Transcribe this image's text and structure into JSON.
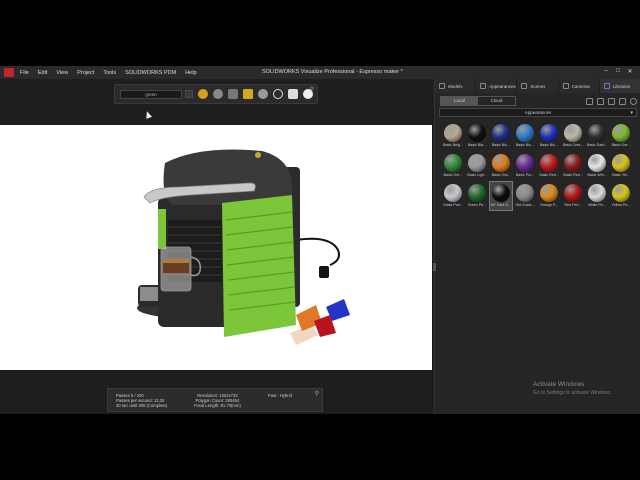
{
  "window": {
    "title": "SOLIDWORKS Visualize Professional - Espresso maker *",
    "controls": [
      "–",
      "□",
      "✕"
    ]
  },
  "menu": [
    "File",
    "Edit",
    "View",
    "Project",
    "Tools",
    "SOLIDWORKS PDM",
    "Help"
  ],
  "toolbar": {
    "select_value": "green",
    "icons": [
      "sun-icon",
      "sphere-icon",
      "car-icon",
      "cube-icon",
      "flask-icon",
      "refresh-icon",
      "camera-icon",
      "render-icon"
    ]
  },
  "stats": {
    "passes": "Passes 6 / 100",
    "passes_per_second": "Passes per second: 13.28",
    "time_until": "30 sec until 300 (Complete)",
    "resolution": "Resolution: 1302x732",
    "polygon_count": "Polygon Count: 285464",
    "focal_length": "Focal Length: 91.70(mm)",
    "mode": "Fast - Hybrid"
  },
  "right_panel": {
    "tabs": [
      "Models",
      "Appearances",
      "Scenes",
      "Cameras",
      "Libraries"
    ],
    "active_tab": "Libraries",
    "toggle": [
      "Local",
      "Cloud"
    ],
    "toggle_active": "Local",
    "dropdown_value": "Appearances",
    "materials": [
      {
        "label": "Basic Beig...",
        "color": "#b8a792"
      },
      {
        "label": "Basic Bla...",
        "color": "#111111"
      },
      {
        "label": "Basic Blu...",
        "color": "#1f2f8a"
      },
      {
        "label": "Basic Blu...",
        "color": "#2f79c8"
      },
      {
        "label": "Basic Blu...",
        "color": "#1e32b8"
      },
      {
        "label": "Basic Crea...",
        "color": "#bdb7a6"
      },
      {
        "label": "Basic Dark...",
        "color": "#2e2e2e"
      },
      {
        "label": "Basic Gre...",
        "color": "#7db82d"
      },
      {
        "label": "Basic Gre...",
        "color": "#2f8a36"
      },
      {
        "label": "Basic Ligh...",
        "color": "#9a9a9a"
      },
      {
        "label": "Basic Ora...",
        "color": "#e07a1a"
      },
      {
        "label": "Basic Pur...",
        "color": "#6a2a9a"
      },
      {
        "label": "Basic Red...",
        "color": "#c41818"
      },
      {
        "label": "Basic Red...",
        "color": "#8a1c1c"
      },
      {
        "label": "Basic Whi...",
        "color": "#e6e6e6"
      },
      {
        "label": "Basic Yel...",
        "color": "#d8c21c"
      },
      {
        "label": "Glass Purr...",
        "color": "#c8c8d0"
      },
      {
        "label": "Green Pe...",
        "color": "#1f6a2a"
      },
      {
        "label": "MT Dark G...",
        "color": "#0d0d0d"
      },
      {
        "label": "Old Crack...",
        "color": "#8a8a8a"
      },
      {
        "label": "Orange P...",
        "color": "#d88a1c"
      },
      {
        "label": "Red Perl...",
        "color": "#b01818"
      },
      {
        "label": "White Pe...",
        "color": "#dadada"
      },
      {
        "label": "Yellow Pe...",
        "color": "#d8c61a"
      }
    ],
    "selected_index": 18
  },
  "watermark": {
    "line1": "Activate Windows",
    "line2": "Go to Settings to activate Windows."
  },
  "colors": {
    "accent_green": "#7cc63a",
    "viewport_bg": "#ffffff",
    "panel_bg": "#252525"
  }
}
